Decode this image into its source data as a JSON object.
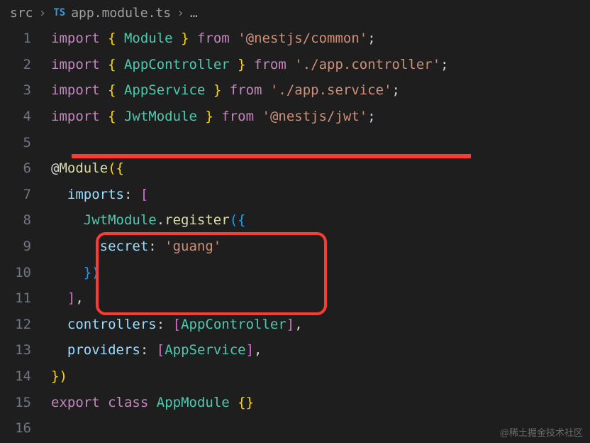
{
  "breadcrumb": {
    "src": "src",
    "badge": "TS",
    "file": "app.module.ts",
    "trail": "…"
  },
  "lines": {
    "l1": {
      "n": "1"
    },
    "l2": {
      "n": "2"
    },
    "l3": {
      "n": "3"
    },
    "l4": {
      "n": "4"
    },
    "l5": {
      "n": "5"
    },
    "l6": {
      "n": "6"
    },
    "l7": {
      "n": "7"
    },
    "l8": {
      "n": "8"
    },
    "l9": {
      "n": "9"
    },
    "l10": {
      "n": "10"
    },
    "l11": {
      "n": "11"
    },
    "l12": {
      "n": "12"
    },
    "l13": {
      "n": "13"
    },
    "l14": {
      "n": "14"
    },
    "l15": {
      "n": "15"
    },
    "l16": {
      "n": "16"
    }
  },
  "tokens": {
    "import": "import",
    "from": "from",
    "export": "export",
    "class": "class",
    "obrace": "{ ",
    "cbrace": " }",
    "Module": "Module",
    "AppController": "AppController",
    "AppService": "AppService",
    "JwtModule": "JwtModule",
    "AppModule": "AppModule",
    "nestcommon": "'@nestjs/common'",
    "appcontroller": "'./app.controller'",
    "appservice": "'./app.service'",
    "nestjwt": "'@nestjs/jwt'",
    "semi": ";",
    "atModule": "@Module",
    "oparen": "(",
    "cparen": ")",
    "obrace2": "{",
    "cbrace2": "}",
    "imports": "imports",
    "controllers": "controllers",
    "providers": "providers",
    "colon": ": ",
    "obracket": "[",
    "cbracket": "]",
    "comma": ",",
    "register": "register",
    "dot": ".",
    "secret": "secret",
    "guang": "'guang'",
    "space2": "  ",
    "space4": "    ",
    "space6": "      "
  },
  "watermark": "@稀土掘金技术社区"
}
